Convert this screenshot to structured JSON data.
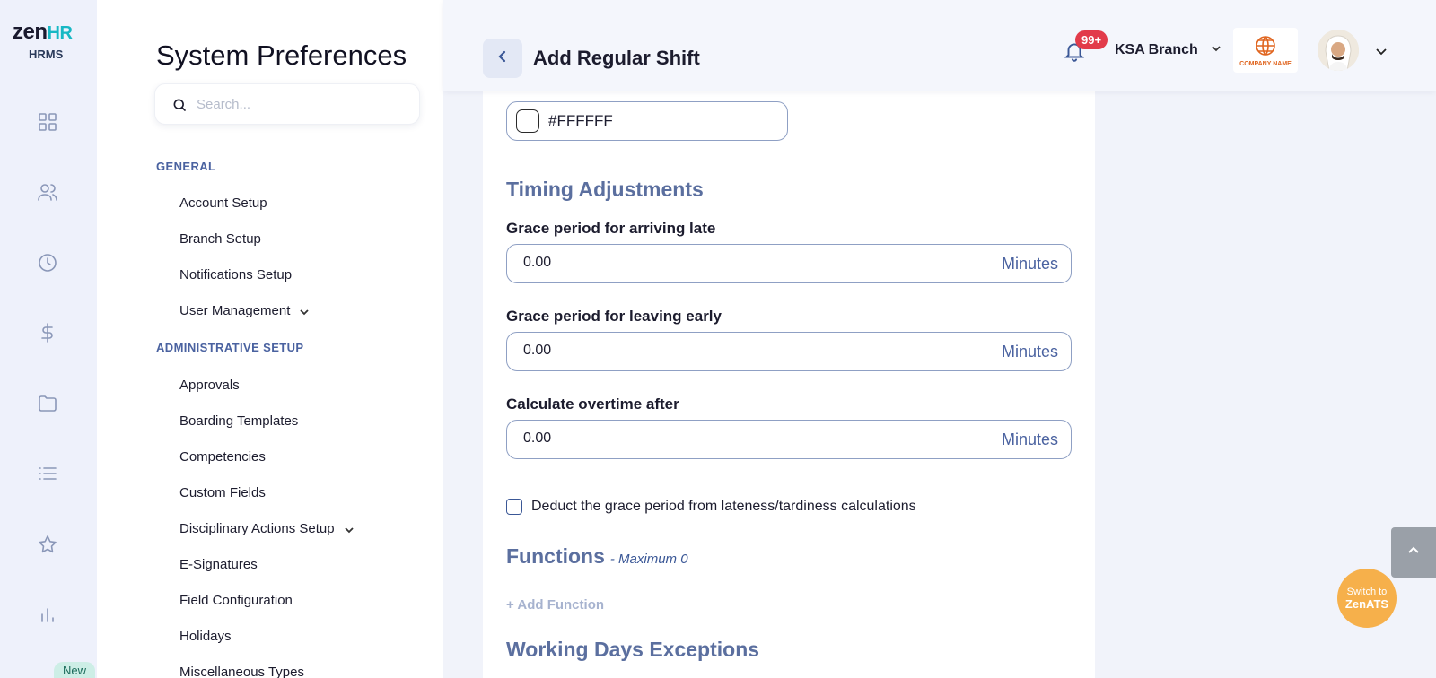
{
  "brand": {
    "logo_main": "zen",
    "logo_accent": "HR",
    "logo_sub": "HRMS"
  },
  "rail_icons": [
    "dashboard-icon",
    "people-icon",
    "clock-icon",
    "dollar-icon",
    "folder-icon",
    "list-icon",
    "star-icon",
    "chart-icon"
  ],
  "rail_badge": "New",
  "nav": {
    "title": "System Preferences",
    "search_placeholder": "Search...",
    "sections": [
      {
        "label": "GENERAL",
        "items": [
          {
            "label": "Account Setup",
            "expandable": false
          },
          {
            "label": "Branch Setup",
            "expandable": false
          },
          {
            "label": "Notifications Setup",
            "expandable": false
          },
          {
            "label": "User Management",
            "expandable": true
          }
        ]
      },
      {
        "label": "ADMINISTRATIVE SETUP",
        "items": [
          {
            "label": "Approvals",
            "expandable": false
          },
          {
            "label": "Boarding Templates",
            "expandable": false
          },
          {
            "label": "Competencies",
            "expandable": false
          },
          {
            "label": "Custom Fields",
            "expandable": false
          },
          {
            "label": "Disciplinary Actions Setup",
            "expandable": true
          },
          {
            "label": "E-Signatures",
            "expandable": false
          },
          {
            "label": "Field Configuration",
            "expandable": false
          },
          {
            "label": "Holidays",
            "expandable": false
          },
          {
            "label": "Miscellaneous Types",
            "expandable": false
          }
        ]
      }
    ]
  },
  "header": {
    "page_title": "Add Regular Shift",
    "notification_count": "99+",
    "branch": "KSA Branch",
    "company_logo_text": "COMPANY NAME"
  },
  "form": {
    "color_value": "#FFFFFF",
    "timing_heading": "Timing Adjustments",
    "fields": [
      {
        "label": "Grace period for arriving late",
        "value": "0.00",
        "unit": "Minutes"
      },
      {
        "label": "Grace period for leaving early",
        "value": "0.00",
        "unit": "Minutes"
      },
      {
        "label": "Calculate overtime after",
        "value": "0.00",
        "unit": "Minutes"
      }
    ],
    "deduct_checkbox_label": "Deduct the grace period from lateness/tardiness calculations",
    "deduct_checked": false,
    "functions_heading": "Functions",
    "functions_max": "- Maximum 0",
    "add_function_label": "+ Add Function",
    "working_days_heading": "Working Days Exceptions"
  },
  "switch_widget": {
    "line1": "Switch to",
    "line2": "ZenATS"
  },
  "colors": {
    "accent": "#3a5796",
    "teal": "#17b8c4",
    "badge_red": "#e23b4a",
    "ats_orange": "#f6b04b"
  }
}
